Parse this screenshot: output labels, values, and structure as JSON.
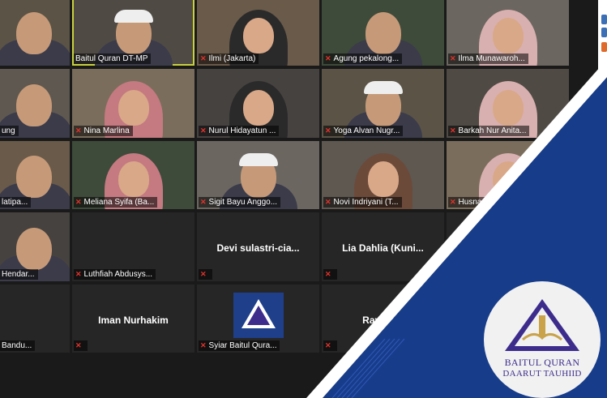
{
  "colors": {
    "active_speaker": "#c8d23c",
    "muted": "#e0322b",
    "brand_blue": "#173c8a",
    "brand_purple": "#3d2c8c"
  },
  "participants": [
    {
      "name": "",
      "show_label": false,
      "video": true
    },
    {
      "name": "Baitul Quran DT-MP",
      "show_label": true,
      "video": true,
      "active": true,
      "muted": false
    },
    {
      "name": "Ilmi (Jakarta)",
      "show_label": true,
      "video": true,
      "muted": true
    },
    {
      "name": "Agung pekalong...",
      "show_label": true,
      "video": true,
      "muted": true
    },
    {
      "name": "Ilma Munawaroh...",
      "show_label": true,
      "video": true,
      "muted": true
    },
    {
      "name": "ung",
      "show_label": true,
      "video": true,
      "muted": false
    },
    {
      "name": "Nina Marlina",
      "show_label": true,
      "video": true,
      "muted": true
    },
    {
      "name": "Nurul Hidayatun ...",
      "show_label": true,
      "video": true,
      "muted": true
    },
    {
      "name": "Yoga Alvan Nugr...",
      "show_label": true,
      "video": true,
      "muted": true
    },
    {
      "name": "Barkah Nur Anita...",
      "show_label": true,
      "video": true,
      "muted": true
    },
    {
      "name": "latipa...",
      "show_label": true,
      "video": true,
      "muted": false
    },
    {
      "name": "Meliana Syifa (Ba...",
      "show_label": true,
      "video": true,
      "muted": true
    },
    {
      "name": "Sigit Bayu Anggo...",
      "show_label": true,
      "video": true,
      "muted": true
    },
    {
      "name": "Novi Indriyani (T...",
      "show_label": true,
      "video": true,
      "muted": true
    },
    {
      "name": "Husna",
      "show_label": true,
      "video": true,
      "muted": true
    },
    {
      "name": "Hendar...",
      "show_label": true,
      "video": true,
      "muted": false
    },
    {
      "name": "Luthfiah Abdusys...",
      "show_label": true,
      "video": false,
      "muted": true
    },
    {
      "name": "",
      "center_name": "Devi sulastri-cia...",
      "show_label": true,
      "video": false,
      "muted": true
    },
    {
      "name": "",
      "center_name": "Lia Dahlia (Kuni...",
      "show_label": true,
      "video": false,
      "muted": true
    },
    {
      "name": "",
      "show_label": false,
      "video": false
    },
    {
      "name": "Bandu...",
      "show_label": true,
      "video": false,
      "muted": false
    },
    {
      "name": "",
      "center_name": "Iman Nurhakim",
      "show_label": true,
      "video": false,
      "muted": true
    },
    {
      "name": "Syiar Baitul Qura...",
      "show_label": true,
      "video": false,
      "muted": true,
      "logo": true
    },
    {
      "name": "",
      "center_name": "Rayhann",
      "show_label": true,
      "video": false,
      "muted": true
    },
    {
      "name": "",
      "show_label": false,
      "video": false
    }
  ],
  "brand": {
    "line1": "BAITUL QURAN",
    "line2": "DAARUT TAUHIID"
  }
}
